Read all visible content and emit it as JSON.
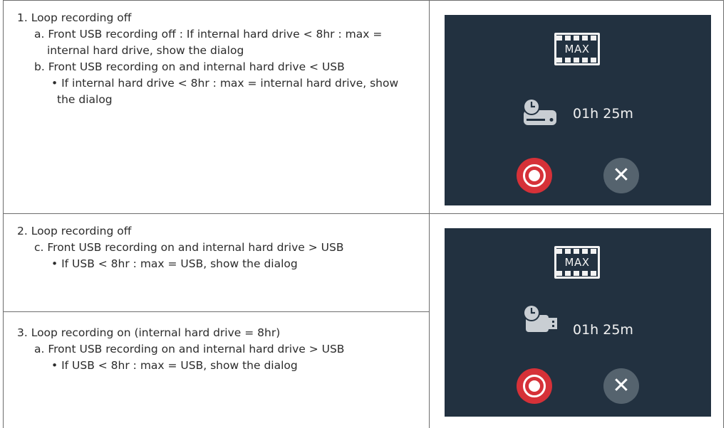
{
  "rows": {
    "row1": {
      "line1": "1. Loop recording off",
      "line2": "a. Front USB recording off : If internal hard drive < 8hr : max =",
      "line3": "internal hard drive, show the dialog",
      "line4": "b. Front USB recording on and internal hard drive < USB",
      "line5": "• If internal hard drive < 8hr : max = internal hard drive, show",
      "line6": "the dialog"
    },
    "row2": {
      "line1": "2. Loop recording off",
      "line2": "c. Front USB recording on and internal hard drive > USB",
      "line3": "• If USB < 8hr : max = USB, show the dialog"
    },
    "row3": {
      "line1": "3. Loop recording on (internal hard drive = 8hr)",
      "line2": "a. Front USB recording on and internal hard drive > USB",
      "line3": "• If USB < 8hr : max = USB, show the dialog"
    }
  },
  "dialogs": {
    "first": {
      "badge": "MAX",
      "duration": "01h 25m",
      "storage_icon": "hard-drive-clock-icon",
      "record_icon": "record-icon",
      "close_icon": "close-icon",
      "colors": {
        "background": "#223140",
        "record": "#d63138",
        "close": "#55636e"
      }
    },
    "second": {
      "badge": "MAX",
      "duration": "01h 25m",
      "storage_icon": "usb-drive-clock-icon",
      "record_icon": "record-icon",
      "close_icon": "close-icon",
      "colors": {
        "background": "#223140",
        "record": "#d63138",
        "close": "#55636e"
      }
    }
  }
}
